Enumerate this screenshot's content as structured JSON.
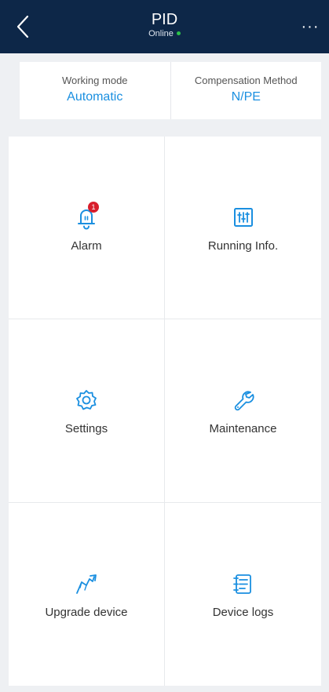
{
  "header": {
    "title": "PID",
    "status": "Online",
    "status_color": "#2bc24a",
    "back_icon": "chevron-left-icon",
    "more_icon": "more-icon",
    "more_glyph": "···"
  },
  "info": {
    "working_mode_label": "Working mode",
    "working_mode_value": "Automatic",
    "compensation_label": "Compensation Method",
    "compensation_value": "N/PE"
  },
  "tiles": [
    {
      "label": "Alarm",
      "icon": "alarm-bell-icon",
      "badge": "1"
    },
    {
      "label": "Running Info.",
      "icon": "running-info-icon"
    },
    {
      "label": "Settings",
      "icon": "gear-icon"
    },
    {
      "label": "Maintenance",
      "icon": "wrench-icon"
    },
    {
      "label": "Upgrade device",
      "icon": "upgrade-icon"
    },
    {
      "label": "Device logs",
      "icon": "logs-icon"
    }
  ],
  "colors": {
    "header_bg": "#0d2748",
    "accent": "#1a8fe0",
    "badge": "#d81e2c"
  }
}
